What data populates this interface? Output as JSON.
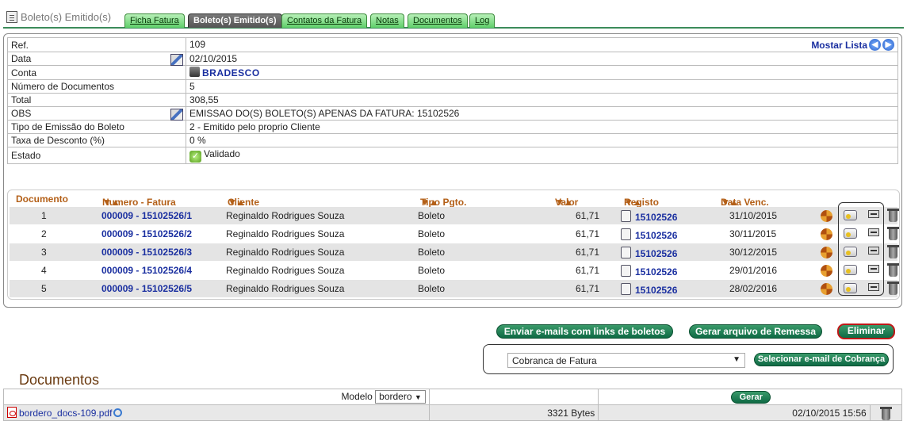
{
  "tabs": {
    "current": "Boleto(s) Emitido(s)",
    "items": [
      "Ficha Fatura",
      "Boleto(s) Emitido(s)",
      "Contatos da Fatura",
      "Notas",
      "Documentos",
      "Log"
    ]
  },
  "info": {
    "mostar": "Mostar Lista",
    "rows": [
      {
        "label": "Ref.",
        "value": "109"
      },
      {
        "label": "Data",
        "value": "02/10/2015"
      },
      {
        "label": "Conta",
        "value": "BRADESCO"
      },
      {
        "label": "Número de Documentos",
        "value": "5"
      },
      {
        "label": "Total",
        "value": "308,55"
      },
      {
        "label": "OBS",
        "value": "EMISSAO DO(S) BOLETO(S) APENAS DA FATURA: 15102526"
      },
      {
        "label": "Tipo de Emissão do Boleto",
        "value": "2 - Emitido pelo proprio Cliente"
      },
      {
        "label": "Taxa de Desconto (%)",
        "value": "0 %"
      },
      {
        "label": "Estado",
        "value": "Validado"
      }
    ]
  },
  "grid": {
    "headers": [
      "Documento",
      "Numero - Fatura",
      "Cliente",
      "Tipo Pgto.",
      "Valor",
      "Registo",
      "Data Venc."
    ],
    "rows": [
      {
        "doc": "1",
        "numero": "000009 - 15102526/1",
        "cliente": "Reginaldo Rodrigues Souza",
        "tipo": "Boleto",
        "valor": "61,71",
        "registo": "15102526",
        "venc": "31/10/2015"
      },
      {
        "doc": "2",
        "numero": "000009 - 15102526/2",
        "cliente": "Reginaldo Rodrigues Souza",
        "tipo": "Boleto",
        "valor": "61,71",
        "registo": "15102526",
        "venc": "30/11/2015"
      },
      {
        "doc": "3",
        "numero": "000009 - 15102526/3",
        "cliente": "Reginaldo Rodrigues Souza",
        "tipo": "Boleto",
        "valor": "61,71",
        "registo": "15102526",
        "venc": "30/12/2015"
      },
      {
        "doc": "4",
        "numero": "000009 - 15102526/4",
        "cliente": "Reginaldo Rodrigues Souza",
        "tipo": "Boleto",
        "valor": "61,71",
        "registo": "15102526",
        "venc": "29/01/2016"
      },
      {
        "doc": "5",
        "numero": "000009 - 15102526/5",
        "cliente": "Reginaldo Rodrigues Souza",
        "tipo": "Boleto",
        "valor": "61,71",
        "registo": "15102526",
        "venc": "28/02/2016"
      }
    ]
  },
  "actions": {
    "enviar": "Enviar e-mails com links de boletos",
    "remessa": "Gerar arquivo de Remessa",
    "eliminar": "Eliminar",
    "select_value": "Cobranca de Fatura",
    "selecionar": "Selecionar e-mail de Cobrança"
  },
  "documentos": {
    "title": "Documentos",
    "modelo_label": "Modelo",
    "modelo_value": "bordero",
    "gerar": "Gerar",
    "file": {
      "name": "bordero_docs-109.pdf",
      "size": "3321 Bytes",
      "date": "02/10/2015 15:56"
    }
  }
}
